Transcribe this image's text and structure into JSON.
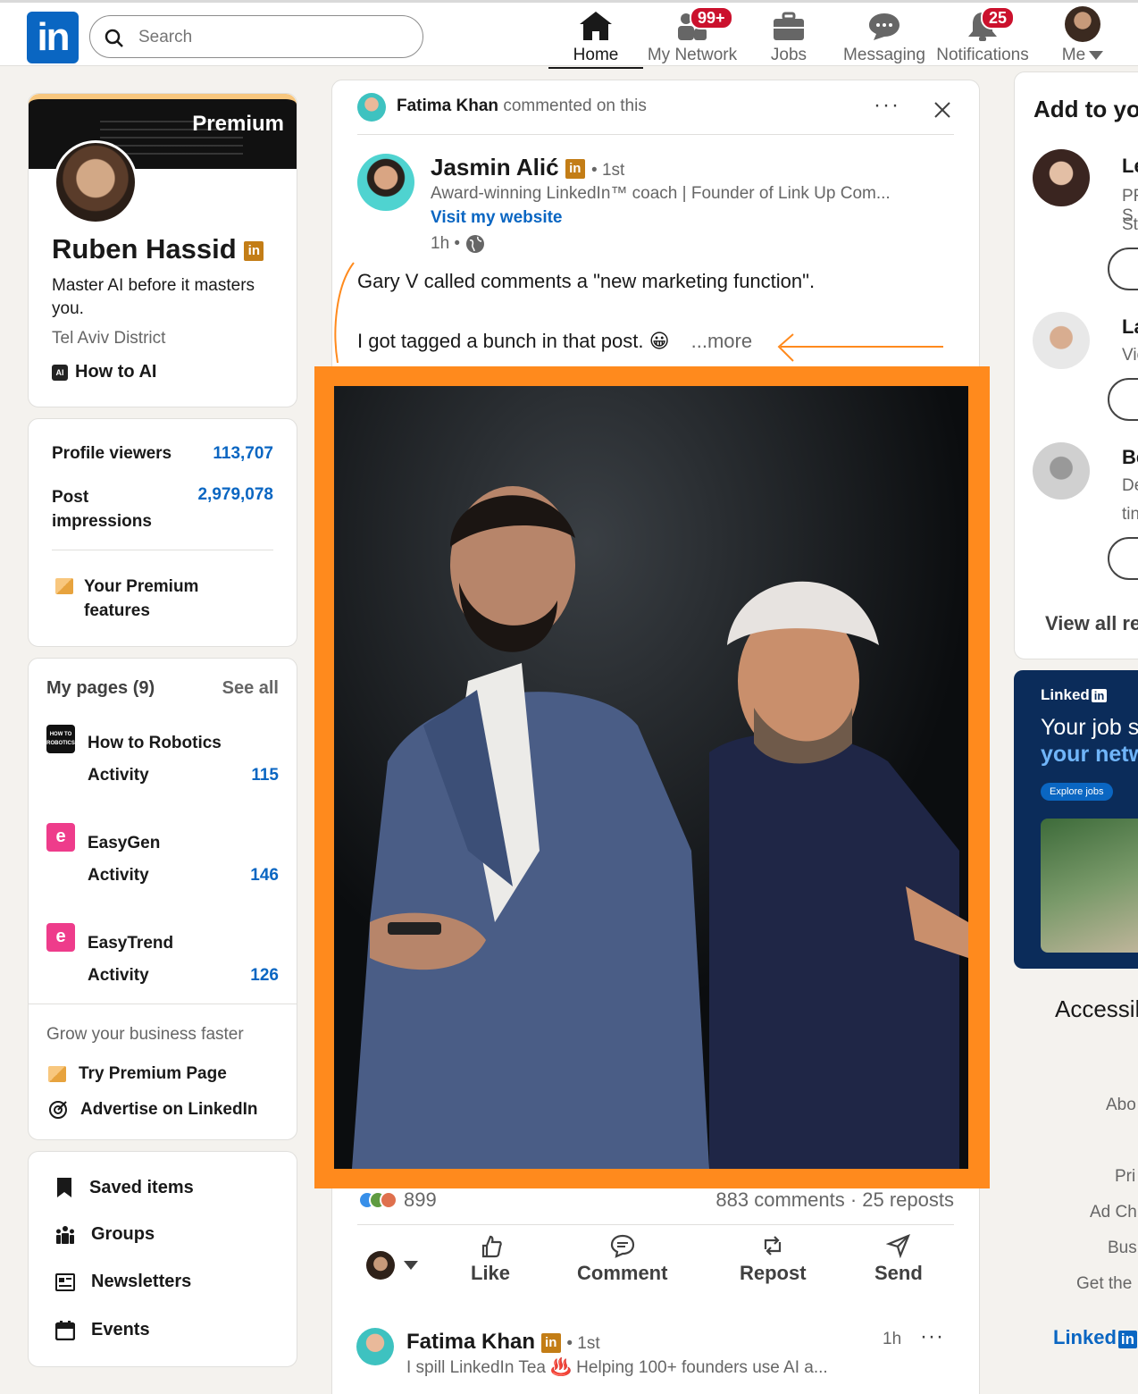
{
  "nav": {
    "search_placeholder": "Search",
    "items": [
      {
        "label": "Home"
      },
      {
        "label": "My Network",
        "badge": "99+"
      },
      {
        "label": "Jobs"
      },
      {
        "label": "Messaging"
      },
      {
        "label": "Notifications",
        "badge": "25"
      },
      {
        "label": "Me"
      }
    ]
  },
  "profile": {
    "banner_text": "Premium",
    "name": "Ruben Hassid",
    "headline": "Master AI before it masters you.",
    "location": "Tel Aviv District",
    "company": "How to AI",
    "company_icon": "AI"
  },
  "stats": {
    "viewers_label": "Profile viewers",
    "viewers_value": "113,707",
    "impressions_label": "Post impressions",
    "impressions_value": "2,979,078",
    "premium_features": "Your Premium features"
  },
  "pages": {
    "title": "My pages (9)",
    "see_all": "See all",
    "activity_label": "Activity",
    "items": [
      {
        "name": "How to Robotics",
        "logo": "HOW TO ROBOTICS",
        "count": "115"
      },
      {
        "name": "EasyGen",
        "logo": "e",
        "count": "146"
      },
      {
        "name": "EasyTrend",
        "logo": "e",
        "count": "126"
      }
    ],
    "grow_text": "Grow your business faster",
    "try_premium": "Try Premium Page",
    "advertise": "Advertise on LinkedIn"
  },
  "shortcuts": {
    "saved": "Saved items",
    "groups": "Groups",
    "newsletters": "Newsletters",
    "events": "Events"
  },
  "post": {
    "commenter": "Fatima Khan",
    "commented_text": "commented on this",
    "author": "Jasmin Alić",
    "degree": "• 1st",
    "author_headline": "Award-winning LinkedIn™ coach | Founder of Link Up Com...",
    "website": "Visit my website",
    "time": "1h •",
    "text_line1": "Gary V called comments a \"new marketing function\".",
    "text_line2": "I got tagged a bunch in that post. 😀",
    "more": "...more",
    "reactions": "899",
    "comments_reposts": "883 comments · 25 reposts",
    "actions": {
      "like": "Like",
      "comment": "Comment",
      "repost": "Repost",
      "send": "Send"
    }
  },
  "comment": {
    "name": "Fatima Khan",
    "degree": "• 1st",
    "time": "1h",
    "headline": "I spill LinkedIn Tea ♨️ Helping 100+ founders use AI a..."
  },
  "right": {
    "title": "Add to you",
    "recs": [
      {
        "name": "Ler",
        "line1": "PR S",
        "line2": "Star"
      },
      {
        "name": "Lau",
        "line1": "Vice",
        "line2": ""
      },
      {
        "name": "Ber",
        "line1": "Dev",
        "line2": "tink"
      }
    ],
    "view_all": "View all re",
    "ad": {
      "brand": "Linked",
      "line1": "Your job s",
      "line2": "your netw",
      "button": "Explore jobs"
    },
    "accessibility": "Accessil",
    "footer": [
      "Abo",
      "Pri",
      "Ad Ch",
      "Bus",
      "Get the"
    ],
    "footer_brand": "Linked"
  },
  "colors": {
    "accent": "#0a66c2",
    "badge": "#cb112d",
    "highlight": "#ff8a1d",
    "premium": "#c37d16"
  }
}
